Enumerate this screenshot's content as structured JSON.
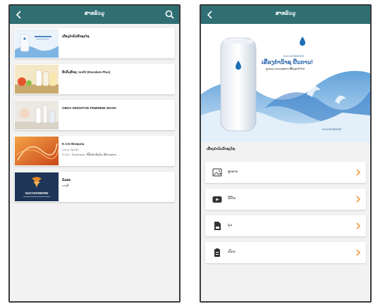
{
  "left_screen": {
    "title": "ສາທລົວມູ",
    "items": [
      {
        "title": "ເຄື່ອງກຳນົດນ້ຳຊະໂຊ",
        "lines": []
      },
      {
        "title": "ນ້ຳດື່ມນ້ຳຊ: Ionfit (Duralum Plus)",
        "lines": []
      },
      {
        "title": "OBSA SENSITIVE FEMININE WASH",
        "lines": []
      },
      {
        "title": "K.V.D Bioquna",
        "lines": [
          "Lo.Lo. No:5/L",
          "K.V.D - Supervisor: ທີ່ປຶກສາທັງມັນ ທີ່ສາວຫຼາຍ ..."
        ]
      },
      {
        "title": "ນົມທະ",
        "lines": [
          "ນາງທີ"
        ]
      }
    ],
    "thumb_logo_text": "SUCCESSMORE"
  },
  "right_screen": {
    "title": "ສາທລົວມູ",
    "hero_brand": "SUCCESSMORE",
    "hero_headline": "ເຄື່ອງກຳນ້ຳຊ ຢືນການ!",
    "hero_tagline": "ຊຸດແນະ ຄວາມສະອາດ ທີ່ສິນລຸກຄ້າໃໝ່",
    "hero_brand_bottom": "SUCCESSMORE",
    "section_title": "ເຄື່ອງກຳນົດນ້ຳຊະໂຊ",
    "menu": [
      {
        "label": "ຮູບພາບ",
        "icon": "image-icon"
      },
      {
        "label": "ວີດີໂອ",
        "icon": "youtube-icon"
      },
      {
        "label": "ຄູ່ມ",
        "icon": "document-icon"
      },
      {
        "label": "ເປີດກ",
        "icon": "clipboard-icon"
      }
    ]
  },
  "colors": {
    "topbar": "#2f6f73",
    "accent": "#f29a38",
    "hero_blue": "#1f5fa8"
  }
}
